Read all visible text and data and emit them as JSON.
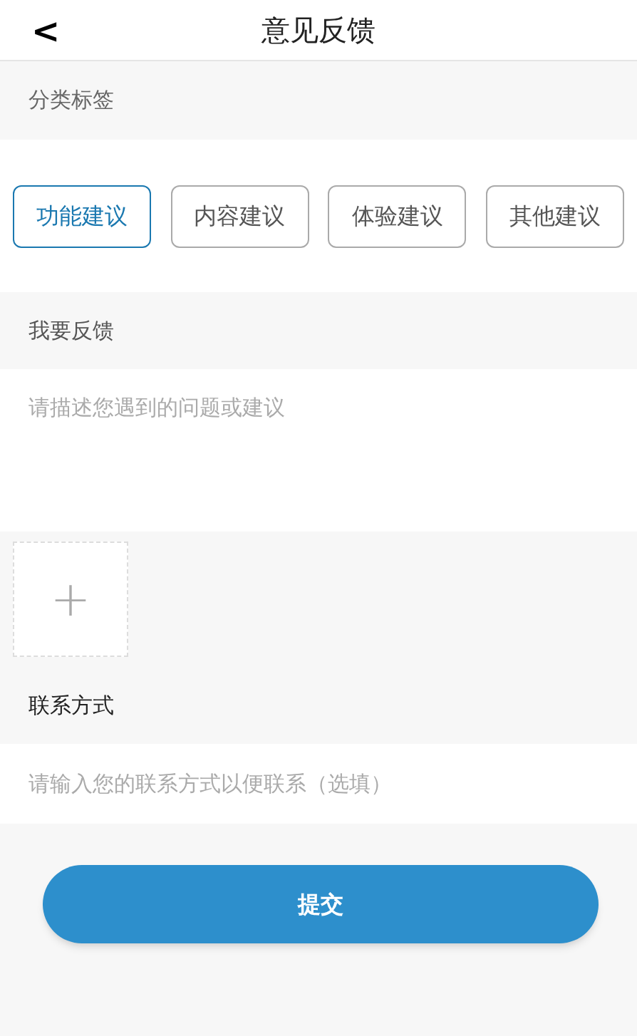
{
  "header": {
    "back": "<",
    "title": "意见反馈"
  },
  "category": {
    "label": "分类标签",
    "tags": [
      {
        "label": "功能建议",
        "selected": true
      },
      {
        "label": "内容建议",
        "selected": false
      },
      {
        "label": "体验建议",
        "selected": false
      },
      {
        "label": "其他建议",
        "selected": false
      }
    ]
  },
  "feedback": {
    "label": "我要反馈",
    "placeholder": "请描述您遇到的问题或建议"
  },
  "upload": {
    "icon": "+"
  },
  "contact": {
    "label": "联系方式",
    "placeholder": "请输入您的联系方式以便联系（选填）"
  },
  "submit": "提交"
}
